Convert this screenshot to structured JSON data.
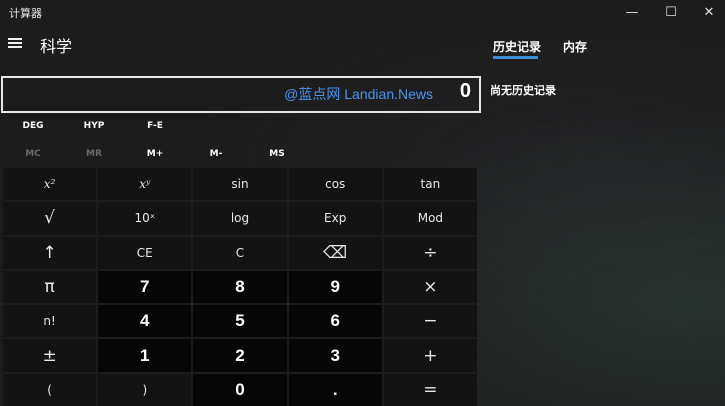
{
  "window": {
    "title": "计算器",
    "minimize_glyph": "—",
    "maximize_glyph": "☐",
    "close_glyph": "✕"
  },
  "header": {
    "menu_icon": "hamburger-icon",
    "mode_title": "科学"
  },
  "side_panel": {
    "tabs": [
      {
        "label": "历史记录",
        "selected": true
      },
      {
        "label": "内存",
        "selected": false
      }
    ],
    "empty_message": "尚无历史记录",
    "accent_color": "#3c8fd8"
  },
  "display": {
    "watermark": "@蓝点网 Landian.News",
    "value": "0"
  },
  "mode_row": {
    "deg": "DEG",
    "hyp": "HYP",
    "fe": "F-E"
  },
  "memory_row": {
    "mc": "MC",
    "mr": "MR",
    "mplus": "M+",
    "mminus": "M-",
    "ms": "MS"
  },
  "keys": {
    "r1": [
      "x²",
      "xʸ",
      "sin",
      "cos",
      "tan"
    ],
    "r2": [
      "√",
      "10ˣ",
      "log",
      "Exp",
      "Mod"
    ],
    "r3": [
      "↑",
      "CE",
      "C",
      "⌫",
      "÷"
    ],
    "r4": [
      "π",
      "7",
      "8",
      "9",
      "×"
    ],
    "r5": [
      "n!",
      "4",
      "5",
      "6",
      "−"
    ],
    "r6": [
      "±",
      "1",
      "2",
      "3",
      "+"
    ],
    "r7": [
      "(",
      ")",
      "0",
      ".",
      "="
    ]
  }
}
